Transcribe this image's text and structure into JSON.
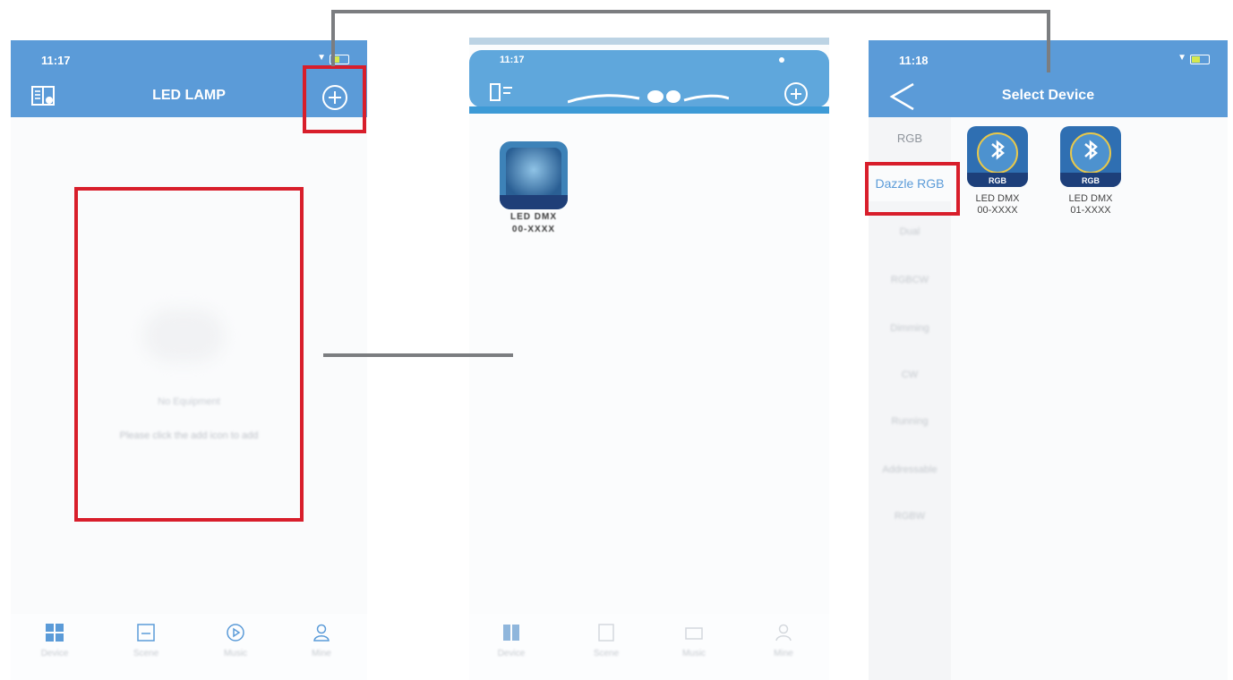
{
  "screens": {
    "home": {
      "time": "11:17",
      "title": "LED LAMP",
      "empty_text_1": "No Equipment",
      "empty_text_2": "Please click the add icon to add",
      "tabs": [
        {
          "label": "Device",
          "icon": "grid-icon"
        },
        {
          "label": "Scene",
          "icon": "scene-icon"
        },
        {
          "label": "Music",
          "icon": "music-play-icon"
        },
        {
          "label": "Mine",
          "icon": "user-icon"
        }
      ]
    },
    "device_list": {
      "time": "11:17",
      "device_name": "LED DMX",
      "device_sub": "00-XXXX",
      "tabs": [
        {
          "label": "Device"
        },
        {
          "label": "Scene"
        },
        {
          "label": "Music"
        },
        {
          "label": "Mine"
        }
      ]
    },
    "select_device": {
      "time": "11:18",
      "title": "Select Device",
      "categories": [
        "RGB",
        "Dazzle RGB",
        "Dual",
        "RGBCW",
        "Dimming",
        "CW",
        "Running",
        "Addressable",
        "RGBW"
      ],
      "devices": [
        {
          "name": "LED DMX",
          "id": "00-XXXX",
          "badge": "RGB"
        },
        {
          "name": "LED DMX",
          "id": "01-XXXX",
          "badge": "RGB"
        }
      ]
    }
  },
  "colors": {
    "header_blue": "#5b9bd8",
    "highlight_red": "#d81e2b",
    "connector_gray": "#7b7d80"
  }
}
